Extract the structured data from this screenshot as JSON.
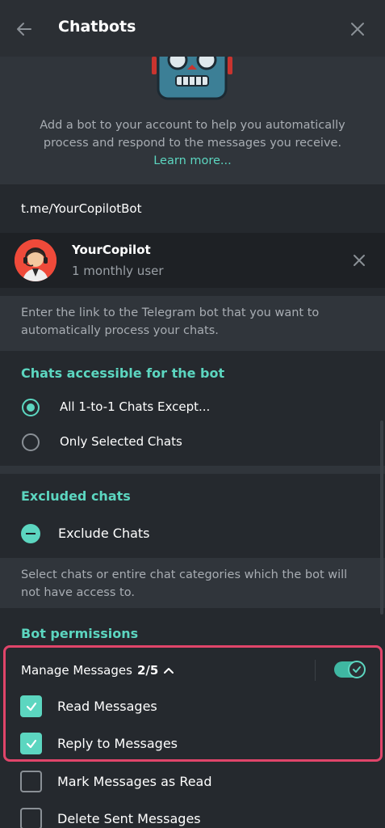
{
  "header": {
    "title": "Chatbots",
    "back_icon": "arrow-left-icon",
    "close_icon": "close-icon"
  },
  "hero": {
    "description": "Add a bot to your account to help you automatically process and respond to the messages you receive.",
    "learn_more": "Learn more..."
  },
  "bot_link": {
    "value": "t.me/YourCopilotBot"
  },
  "bot": {
    "name": "YourCopilot",
    "users": "1 monthly user"
  },
  "info": {
    "text": "Enter the link to the Telegram bot that you want to automatically process your chats."
  },
  "access": {
    "title": "Chats accessible for the bot",
    "options": [
      {
        "label": "All 1-to-1 Chats Except...",
        "selected": true
      },
      {
        "label": "Only Selected Chats",
        "selected": false
      }
    ]
  },
  "excluded": {
    "title": "Excluded chats",
    "action": "Exclude Chats",
    "hint": "Select chats or entire chat categories which the bot will not have access to."
  },
  "permissions": {
    "title": "Bot permissions",
    "manage_label": "Manage Messages",
    "manage_count": "2/5",
    "toggle_on": true,
    "items": [
      {
        "label": "Read Messages",
        "checked": true
      },
      {
        "label": "Reply to Messages",
        "checked": true
      },
      {
        "label": "Mark Messages as Read",
        "checked": false
      },
      {
        "label": "Delete Sent Messages",
        "checked": false
      }
    ]
  },
  "colors": {
    "accent": "#5cd6c0",
    "highlight": "#e0456a",
    "background": "#25292e"
  }
}
